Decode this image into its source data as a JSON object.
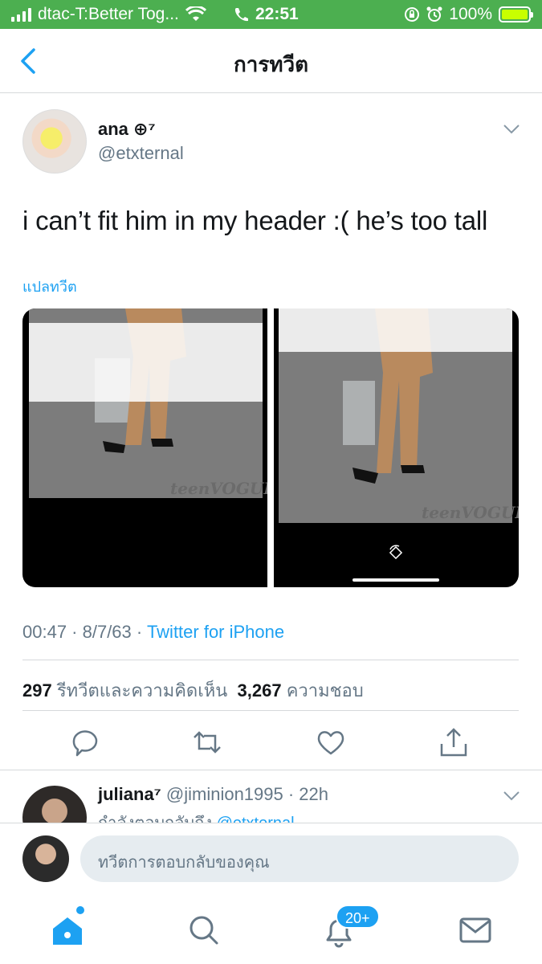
{
  "status_bar": {
    "carrier": "dtac-T:Better Tog...",
    "time": "22:51",
    "battery": "100%"
  },
  "nav": {
    "title": "การทวีต"
  },
  "tweet": {
    "name": "ana ⊕⁷",
    "handle": "@etxternal",
    "text": "i can’t fit him in my header :( he’s too tall",
    "translate": "แปลทวีต",
    "media_watermark": "teenVOGUE",
    "time": "00:47 · 8/7/63 · ",
    "source": "Twitter for iPhone",
    "retweets_count": "297",
    "retweets_label": "รีทวีตและความคิดเห็น",
    "likes_count": "3,267",
    "likes_label": "ความชอบ"
  },
  "reply": {
    "name": "juliana⁷",
    "handle_time": "@jiminion1995 · 22h",
    "replying_to": "กำลังตอบกลับถึง",
    "replying_handle": "@etxternal"
  },
  "composer": {
    "placeholder": "ทวีตการตอบกลับของคุณ"
  },
  "tabbar": {
    "notifications_badge": "20+"
  },
  "colors": {
    "accent": "#1da1f2",
    "status_bar": "#4caf50",
    "secondary_text": "#657786"
  }
}
